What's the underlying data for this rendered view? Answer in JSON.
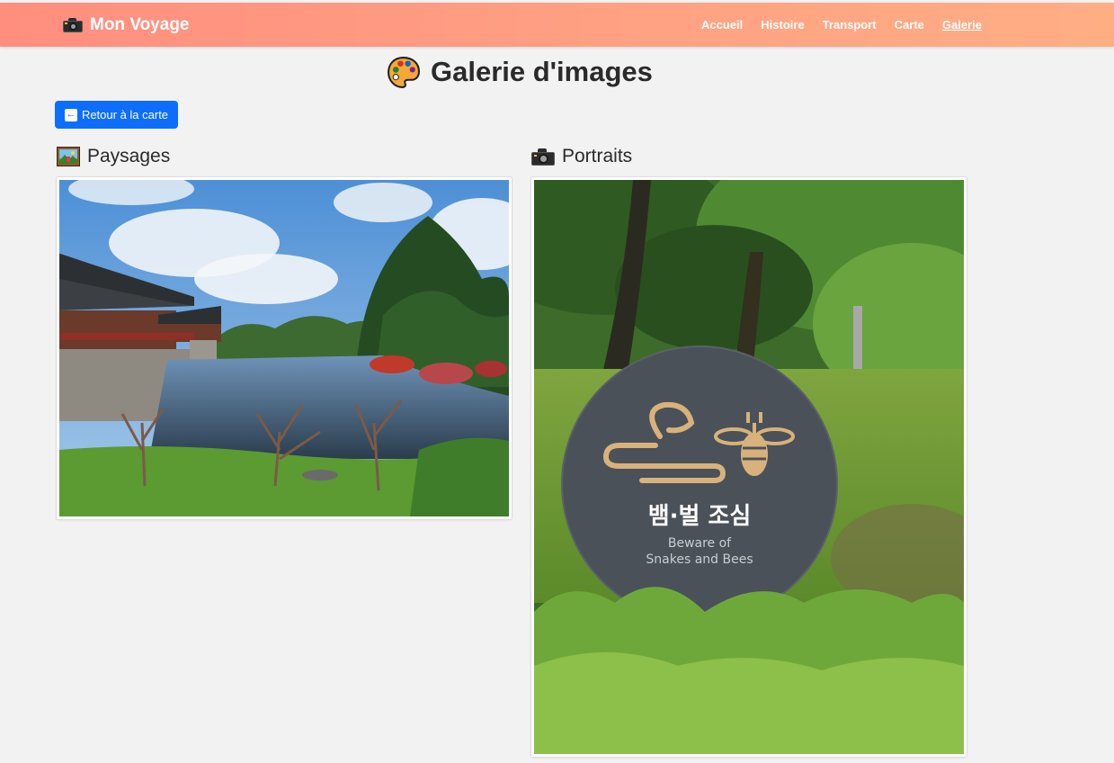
{
  "header": {
    "brand": "Mon Voyage",
    "nav": [
      "Accueil",
      "Histoire",
      "Transport",
      "Carte",
      "Galerie"
    ],
    "active": "Galerie"
  },
  "page": {
    "title": "Galerie d'images",
    "back_label": "Retour à la carte"
  },
  "sections": [
    {
      "title": "Paysages",
      "icon": "framed-picture-icon"
    },
    {
      "title": "Portraits",
      "icon": "camera-icon"
    }
  ],
  "sign": {
    "korean": "뱀·벌 조심",
    "english_line1": "Beware of",
    "english_line2": "Snakes and Bees"
  },
  "colors": {
    "header_start": "#ff8e7f",
    "header_end": "#ffae84",
    "button": "#0d6efd",
    "background": "#f2f2f2"
  }
}
